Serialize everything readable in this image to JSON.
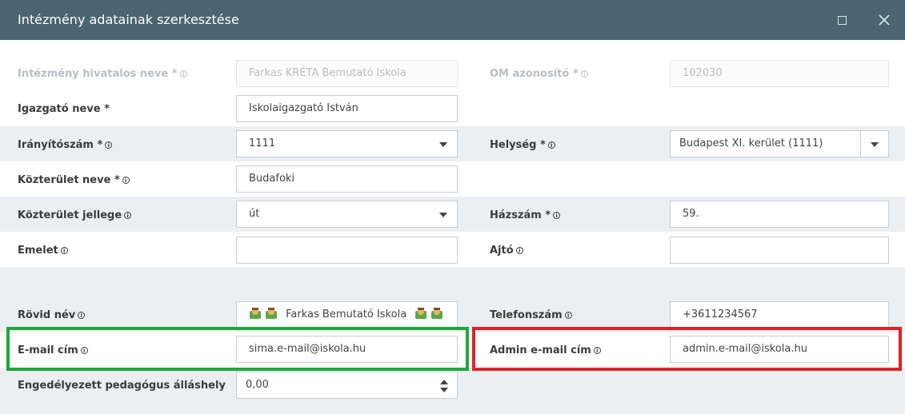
{
  "dialog": {
    "title": "Intézmény adatainak szerkesztése"
  },
  "info_icon_glyph": "i",
  "fields": {
    "hivatalos_nev": {
      "label": "Intézmény hivatalos neve *",
      "value": "Farkas KRÉTA Bemutató Iskola"
    },
    "om_azonosito": {
      "label": "OM azonosító *",
      "value": "102030"
    },
    "igazgato": {
      "label": "Igazgató neve *",
      "value": "Iskolaigazgató István"
    },
    "iranyitoszam": {
      "label": "Irányítószám *",
      "value": "1111"
    },
    "helyseg": {
      "label": "Helység *",
      "value": "Budapest XI. kerület (1111)"
    },
    "kozterulet_neve": {
      "label": "Közterület neve *",
      "value": "Budafoki"
    },
    "kozterulet_jellege": {
      "label": "Közterület jellege",
      "value": "út"
    },
    "hazszam": {
      "label": "Házszám *",
      "value": "59."
    },
    "emelet": {
      "label": "Emelet",
      "value": ""
    },
    "ajto": {
      "label": "Ajtó",
      "value": ""
    },
    "rovid_nev": {
      "label": "Rövid név",
      "value": "Farkas Bemutató Iskola"
    },
    "telefonszam": {
      "label": "Telefonszám",
      "value": "+3611234567"
    },
    "email": {
      "label": "E-mail cím",
      "value": "sima.e-mail@iskola.hu"
    },
    "admin_email": {
      "label": "Admin e-mail cím",
      "value": "admin.e-mail@iskola.hu"
    },
    "allashely": {
      "label": "Engedélyezett pedagógus álláshely",
      "value": "0,00"
    }
  },
  "colors": {
    "titlebar": "#4a6470",
    "highlight_green": "#1fa83a",
    "highlight_red": "#e0202a"
  }
}
